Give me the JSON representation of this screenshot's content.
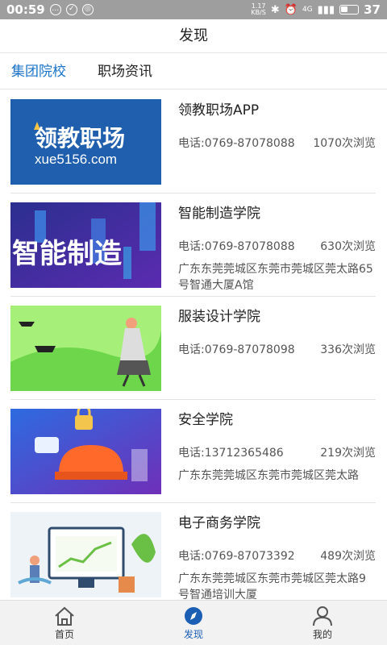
{
  "status_bar": {
    "time": "00:59",
    "net_speed_value": "1.17",
    "net_speed_unit": "KB/S",
    "signal_label": "4G",
    "battery": "37"
  },
  "header": {
    "title": "发现"
  },
  "tabs": [
    {
      "label": "集团院校",
      "active": true
    },
    {
      "label": "职场资讯",
      "active": false
    }
  ],
  "items": [
    {
      "title": "领教职场APP",
      "phone": "电话:0769-87078088",
      "views": "1070次浏览",
      "address": "",
      "thumb_text_main": "领教职场",
      "thumb_text_sub": "xue5156.com"
    },
    {
      "title": "智能制造学院",
      "phone": "电话:0769-87078088",
      "views": "630次浏览",
      "address": "广东东莞莞城区东莞市莞城区莞太路65号智通大厦A馆",
      "thumb_text_main": "智能制造"
    },
    {
      "title": "服装设计学院",
      "phone": "电话:0769-87078098",
      "views": "336次浏览",
      "address": ""
    },
    {
      "title": "安全学院",
      "phone": "电话:13712365486",
      "views": "219次浏览",
      "address": "广东东莞莞城区东莞市莞城区莞太路"
    },
    {
      "title": "电子商务学院",
      "phone": "电话:0769-87073392",
      "views": "489次浏览",
      "address": "广东东莞莞城区东莞市莞城区莞太路9号智通培训大厦"
    }
  ],
  "bottom_nav": [
    {
      "label": "首页",
      "icon": "home-icon",
      "active": false
    },
    {
      "label": "发现",
      "icon": "compass-icon",
      "active": true
    },
    {
      "label": "我的",
      "icon": "user-icon",
      "active": false
    }
  ],
  "colors": {
    "accent": "#1a73c8",
    "status_bar": "#9e9e9e"
  }
}
